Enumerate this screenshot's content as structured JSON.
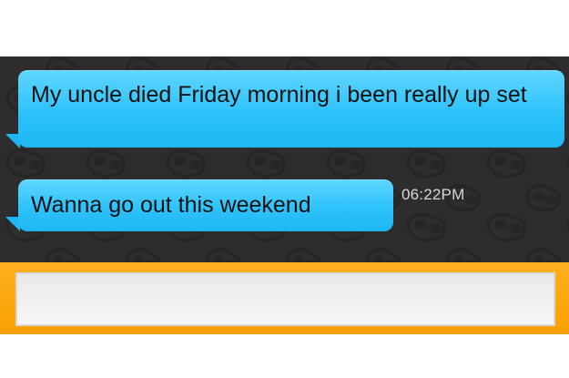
{
  "conversation": {
    "messages": [
      {
        "text": "My uncle died Friday morning i been really up set"
      },
      {
        "text": "Wanna go out this weekend",
        "time": "06:22PM"
      }
    ]
  },
  "composer": {
    "value": "",
    "placeholder": ""
  },
  "colors": {
    "chat_background": "#2d2d2d",
    "bubble": "#2ec2fb",
    "composer_bar": "#f8a000",
    "composer_field": "#efefef",
    "timestamp": "#d8d8d8"
  },
  "icons": {
    "background_pattern": "masked-face-doodle-icon"
  }
}
